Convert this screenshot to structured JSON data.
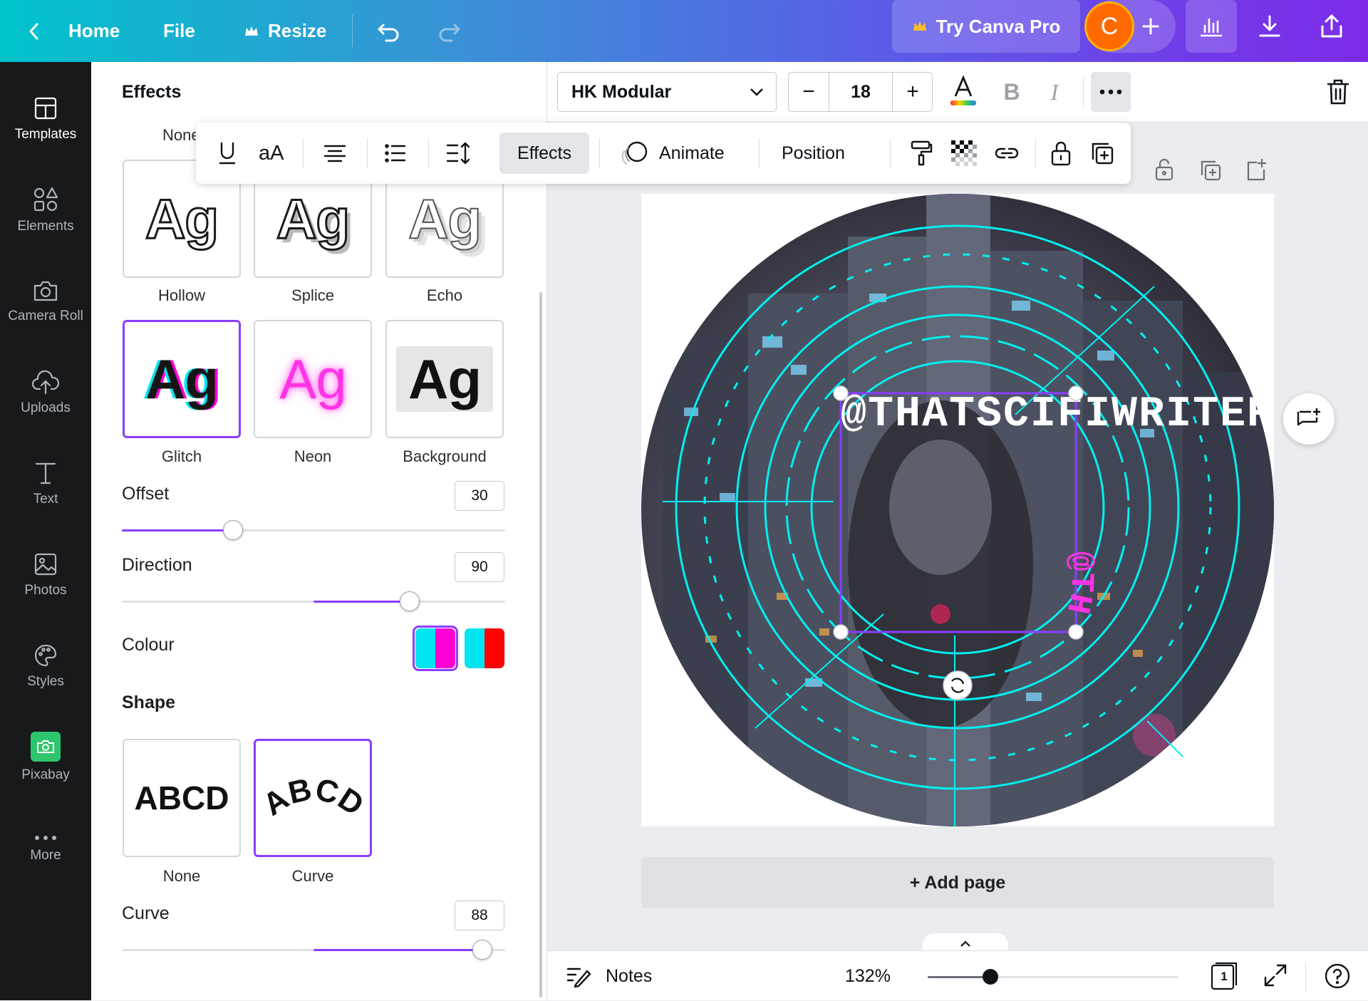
{
  "topbar": {
    "home_label": "Home",
    "file_label": "File",
    "resize_label": "Resize",
    "try_pro_label": "Try Canva Pro",
    "avatar_letter": "C"
  },
  "rail": {
    "items": [
      {
        "label": "Templates",
        "icon": "templates-icon"
      },
      {
        "label": "Elements",
        "icon": "elements-icon"
      },
      {
        "label": "Camera Roll",
        "icon": "camera-icon"
      },
      {
        "label": "Uploads",
        "icon": "upload-icon"
      },
      {
        "label": "Text",
        "icon": "text-icon"
      },
      {
        "label": "Photos",
        "icon": "photos-icon"
      },
      {
        "label": "Styles",
        "icon": "palette-icon"
      },
      {
        "label": "Pixabay",
        "icon": "pixabay-icon"
      },
      {
        "label": "More",
        "icon": "more-icon"
      }
    ]
  },
  "panel": {
    "title": "Effects",
    "partial_label": "None",
    "style_cards": [
      {
        "sample": "Ag",
        "label": "Hollow"
      },
      {
        "sample": "Ag",
        "label": "Splice"
      },
      {
        "sample": "Ag",
        "label": "Echo"
      },
      {
        "sample": "Ag",
        "label": "Glitch",
        "selected": true
      },
      {
        "sample": "Ag",
        "label": "Neon"
      },
      {
        "sample": "Ag",
        "label": "Background"
      }
    ],
    "offset": {
      "label": "Offset",
      "value": "30",
      "level": 0.29
    },
    "direction": {
      "label": "Direction",
      "value": "90",
      "level": 0.75
    },
    "colour": {
      "label": "Colour",
      "swatch1": [
        "#00e5f0",
        "#ff00d4"
      ],
      "swatch2": [
        "#00e5f0",
        "#ff0000"
      ]
    },
    "shape": {
      "label": "Shape",
      "cards": [
        {
          "sample": "ABCD",
          "label": "None"
        },
        {
          "sample": "ABCD",
          "label": "Curve",
          "selected": true
        }
      ]
    },
    "curve": {
      "label": "Curve",
      "value": "88",
      "level": 0.94
    }
  },
  "toolbar": {
    "font_name": "HK Modular",
    "font_size": "18"
  },
  "floatbar": {
    "case_label": "aA",
    "effects_label": "Effects",
    "animate_label": "Animate",
    "position_label": "Position"
  },
  "canvas": {
    "straight_text": "@THATSCIFIWRITER",
    "curved_text": "@THATSCIFIWRITER",
    "accent": "#00f0f0",
    "text_color": "#ff33e6"
  },
  "add_page_label": "+ Add page",
  "bottombar": {
    "notes_label": "Notes",
    "zoom_label": "132%",
    "zoom_level": 0.25,
    "page_count": "1"
  },
  "colors": {
    "accent_purple": "#8b3dff",
    "rail_bg": "#18191b",
    "avatar_orange": "#ff6a00"
  }
}
